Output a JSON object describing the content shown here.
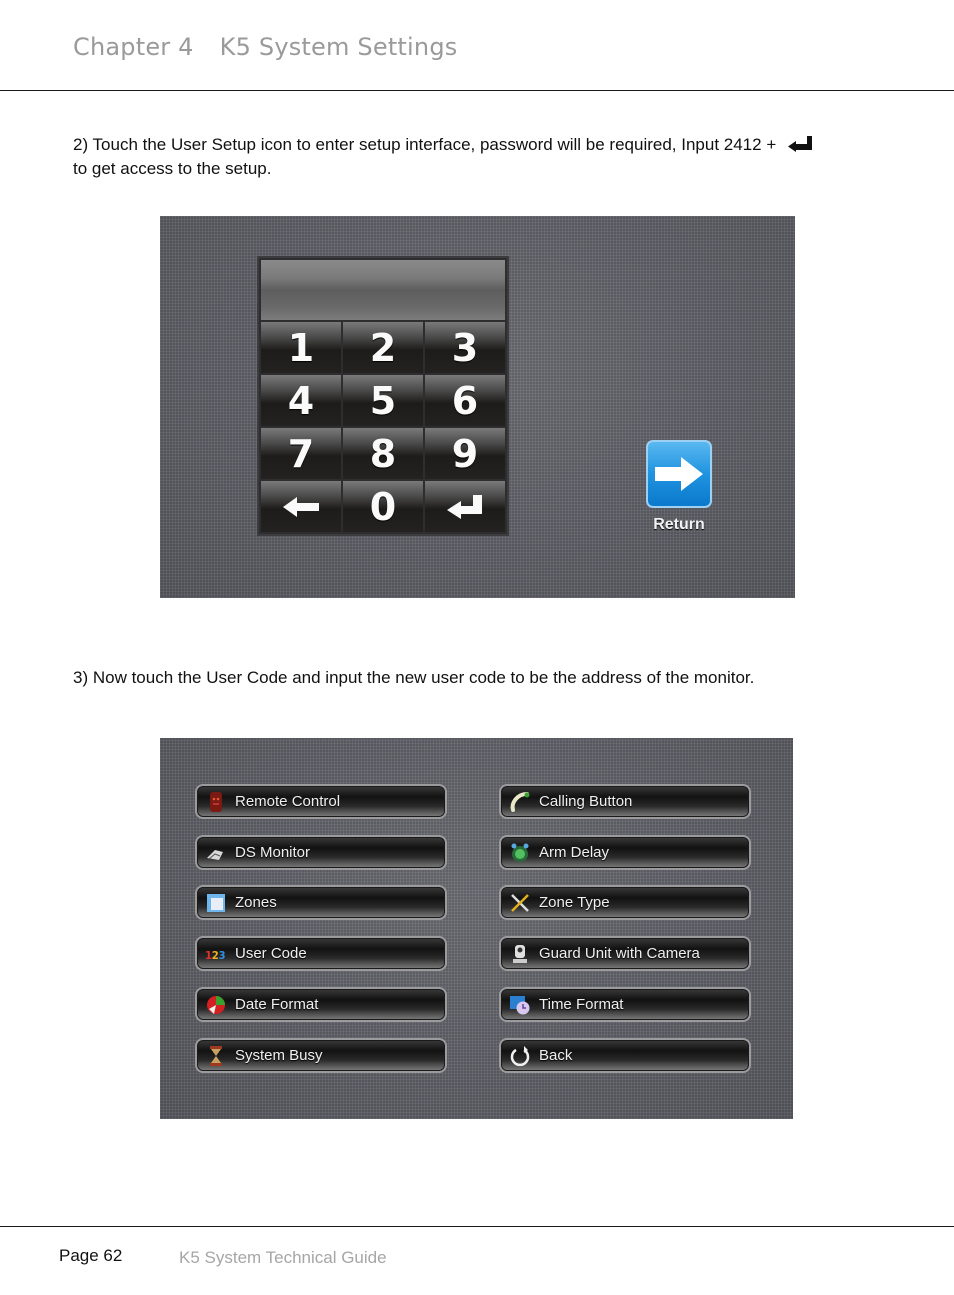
{
  "header": {
    "chapter": "Chapter 4",
    "title": "K5 System Settings"
  },
  "steps": {
    "step2_text": "2) Touch the User Setup icon to enter setup interface, password will be required, Input 2412 +",
    "step2_text_cont": "to get access to the setup.",
    "step2_inline_icon": "enter-icon",
    "step3_text": "3) Now touch the User Code and input the new user code to be the address of the monitor."
  },
  "keypad_screen": {
    "display_value": "",
    "keys": [
      {
        "label": "1",
        "name": "key-1"
      },
      {
        "label": "2",
        "name": "key-2"
      },
      {
        "label": "3",
        "name": "key-3"
      },
      {
        "label": "4",
        "name": "key-4"
      },
      {
        "label": "5",
        "name": "key-5"
      },
      {
        "label": "6",
        "name": "key-6"
      },
      {
        "label": "7",
        "name": "key-7"
      },
      {
        "label": "8",
        "name": "key-8"
      },
      {
        "label": "9",
        "name": "key-9"
      },
      {
        "label": "",
        "name": "key-backspace",
        "icon": "left-arrow-icon"
      },
      {
        "label": "0",
        "name": "key-0"
      },
      {
        "label": "",
        "name": "key-enter",
        "icon": "enter-icon"
      }
    ],
    "return_label": "Return",
    "return_icon": "right-arrow-icon",
    "accent_color": "#1f93e0"
  },
  "settings_menu": {
    "left": [
      {
        "label": "Remote Control",
        "icon": "remote-control-icon"
      },
      {
        "label": "DS Monitor",
        "icon": "monitor-icon"
      },
      {
        "label": "Zones",
        "icon": "window-icon"
      },
      {
        "label": "User Code",
        "icon": "numbers-123-icon"
      },
      {
        "label": "Date Format",
        "icon": "date-ball-icon"
      },
      {
        "label": "System Busy",
        "icon": "hourglass-icon"
      }
    ],
    "right": [
      {
        "label": "Calling Button",
        "icon": "phone-handset-icon"
      },
      {
        "label": "Arm Delay",
        "icon": "alarm-clock-icon"
      },
      {
        "label": "Zone Type",
        "icon": "tools-icon"
      },
      {
        "label": "Guard Unit with Camera",
        "icon": "guard-unit-icon"
      },
      {
        "label": "Time Format",
        "icon": "clock-calendar-icon"
      },
      {
        "label": "Back",
        "icon": "back-arrow-icon"
      }
    ]
  },
  "footer": {
    "page": "Page 62",
    "guide_title": "K5 System Technical Guide"
  }
}
